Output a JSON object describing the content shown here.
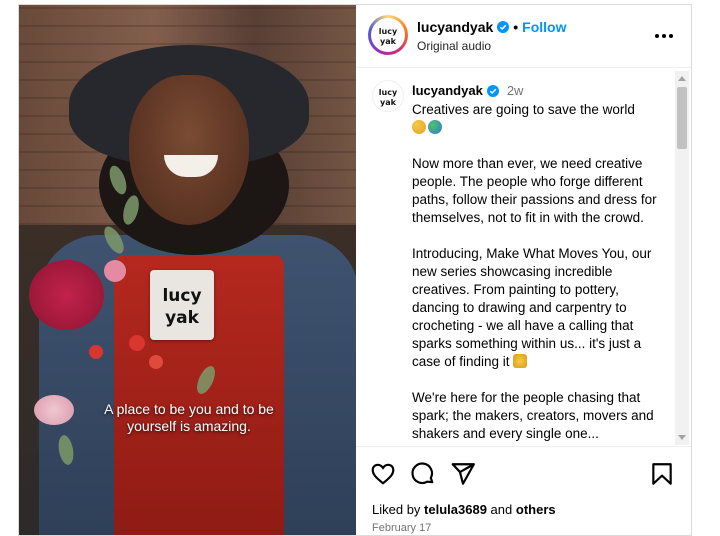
{
  "post": {
    "username": "lucyandyak",
    "follow_label": "Follow",
    "audio_label": "Original audio",
    "brand_colors": {
      "follow": "#0095f6",
      "verified": "#0095f6"
    }
  },
  "media": {
    "caption_line1": "A place to be you and to be",
    "caption_line2": "yourself is amazing."
  },
  "comment": {
    "username": "lucyandyak",
    "time": "2w",
    "paragraph1": "Creatives are going to save the world",
    "paragraph2": "Now more than ever, we need creative people. The people who forge different paths, follow their passions and dress for themselves, not to fit in with the crowd.",
    "paragraph3": "Introducing, Make What Moves You, our new series showcasing incredible creatives. From painting to pottery, dancing to drawing and carpentry to crocheting - we all have a calling that sparks something within us... it's just a case of finding it",
    "paragraph4": "We're here for the people chasing that spark; the makers, creators, movers and shakers and every single one..."
  },
  "footer": {
    "liked_by_prefix": "Liked by",
    "liked_by_user": "telula3689",
    "liked_by_and": "and",
    "liked_by_others": "others",
    "date": "February 17"
  },
  "icons": [
    "heart-icon",
    "comment-icon",
    "share-icon",
    "bookmark-icon",
    "more-icon",
    "verified-icon"
  ]
}
